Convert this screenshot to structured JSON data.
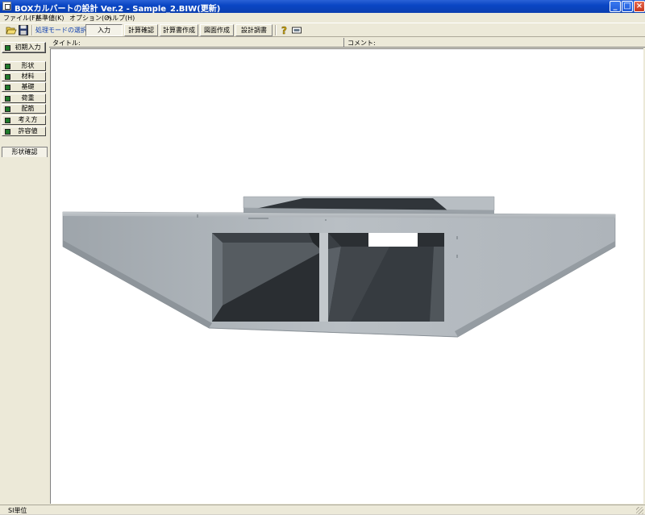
{
  "window": {
    "title": "BOXカルバートの設計 Ver.2 - Sample_2.BIW(更新)",
    "controls": {
      "minimize": "_",
      "maximize": "□",
      "close": "×"
    }
  },
  "menu": [
    "ファイル(F)",
    "基準値(K)",
    "オプション(O)",
    "ヘルプ(H)"
  ],
  "toolbar": {
    "open_icon": "folder-open-icon",
    "save_icon": "floppy-disk-icon",
    "mode_label": "処理モードの選択",
    "modes": [
      "入力",
      "計算確認",
      "計算書作成",
      "図面作成",
      "設計調書"
    ],
    "active_mode": "入力",
    "help_icon": "question-mark-icon",
    "screen_icon": "screen-icon"
  },
  "left_panel": {
    "initial_input": "初期入力",
    "items": [
      "形状",
      "材料",
      "基礎",
      "荷重",
      "配筋",
      "考え方",
      "許容値"
    ],
    "check_color": "#1f7a2a",
    "shape_check_tab": "形状確認"
  },
  "header": {
    "title_label": "タイトル:",
    "comment_label": "コメント:"
  },
  "status": {
    "text": "SI単位"
  },
  "colors": {
    "titlebar": "#0a46c4",
    "canvas": "#ffffff",
    "model_light": "#b6bcc1",
    "model_dark": "#33373b"
  }
}
